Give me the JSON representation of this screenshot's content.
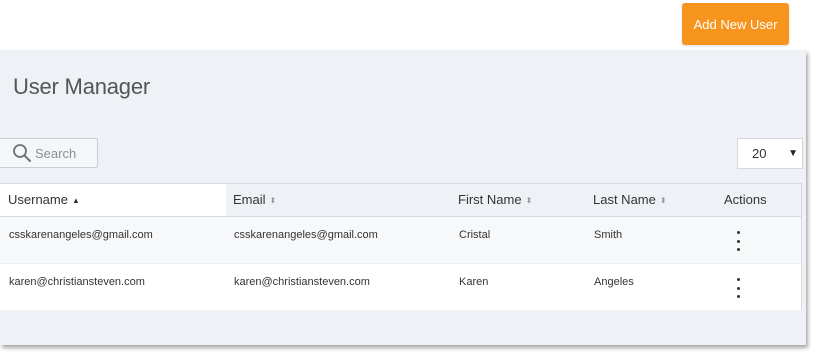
{
  "header": {
    "add_user_label": "Add New User"
  },
  "page": {
    "title": "User Manager"
  },
  "search": {
    "placeholder": "Search"
  },
  "page_size": {
    "value": "20"
  },
  "table": {
    "columns": [
      {
        "label": "Username",
        "sort": "asc"
      },
      {
        "label": "Email",
        "sort": "none"
      },
      {
        "label": "First Name",
        "sort": "none"
      },
      {
        "label": "Last Name",
        "sort": "none"
      },
      {
        "label": "Actions",
        "sort": null
      }
    ],
    "rows": [
      {
        "username": "csskarenangeles@gmail.com",
        "email": "csskarenangeles@gmail.com",
        "first_name": "Cristal",
        "last_name": "Smith"
      },
      {
        "username": "karen@christiansteven.com",
        "email": "karen@christiansteven.com",
        "first_name": "Karen",
        "last_name": "Angeles"
      }
    ]
  },
  "colors": {
    "accent": "#f7941d",
    "panel_bg": "#eef1f5"
  }
}
